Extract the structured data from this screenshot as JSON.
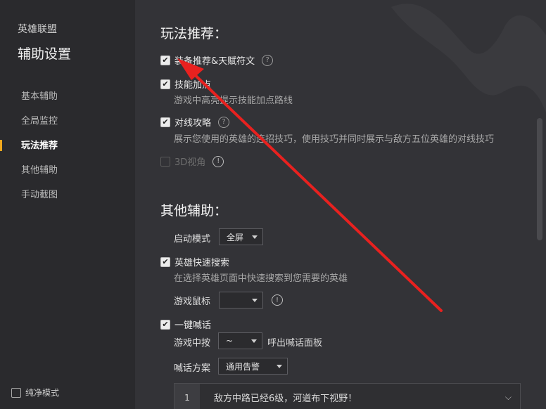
{
  "sidebar": {
    "app_title": "英雄联盟",
    "page_title": "辅助设置",
    "items": [
      {
        "label": "基本辅助"
      },
      {
        "label": "全局监控"
      },
      {
        "label": "玩法推荐"
      },
      {
        "label": "其他辅助"
      },
      {
        "label": "手动截图"
      }
    ],
    "active_index": 2,
    "pure_mode_label": "纯净模式"
  },
  "main": {
    "section1_title": "玩法推荐：",
    "equip": {
      "label": "装备推荐&天赋符文",
      "checked": true
    },
    "skill": {
      "label": "技能加点",
      "desc": "游戏中高亮提示技能加点路线",
      "checked": true
    },
    "lane": {
      "label": "对线攻略",
      "desc": "展示您使用的英雄的连招技巧，使用技巧并同时展示与敌方五位英雄的对线技巧",
      "checked": true
    },
    "view3d": {
      "label": "3D视角",
      "checked": false,
      "disabled": true
    },
    "section2_title": "其他辅助：",
    "launch": {
      "label": "启动模式",
      "value": "全屏"
    },
    "hero_search": {
      "label": "英雄快速搜索",
      "desc": "在选择英雄页面中快速搜索到您需要的英雄",
      "checked": true
    },
    "mouse": {
      "label": "游戏鼠标",
      "value": ""
    },
    "shout": {
      "label": "一键喊话",
      "checked": true
    },
    "shout_key": {
      "prefix": "游戏中按",
      "value": "~",
      "suffix": "呼出喊话面板"
    },
    "shout_scheme": {
      "label": "喊话方案",
      "value": "通用告警"
    },
    "scheme_item": {
      "num": "1",
      "text": "敌方中路已经6级，河道布下视野！"
    }
  },
  "glyphs": {
    "check": "✔",
    "question": "?",
    "bang": "!",
    "chevron": "⌵"
  },
  "colors": {
    "active_marker": "#f2a81d",
    "annotation_arrow": "#e8211f"
  }
}
